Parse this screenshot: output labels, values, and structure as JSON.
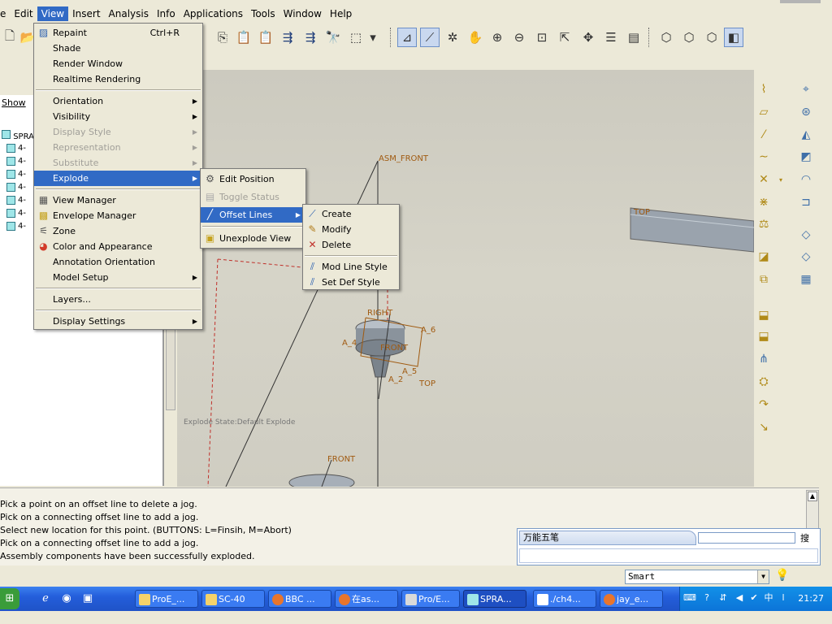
{
  "menubar": {
    "items": [
      "e",
      "Edit",
      "View",
      "Insert",
      "Analysis",
      "Info",
      "Applications",
      "Tools",
      "Window",
      "Help"
    ]
  },
  "view_menu": {
    "items": [
      {
        "label": "Repaint",
        "shortcut": "Ctrl+R"
      },
      {
        "label": "Shade"
      },
      {
        "label": "Render Window"
      },
      {
        "label": "Realtime Rendering"
      },
      {
        "label": "Orientation"
      },
      {
        "label": "Visibility"
      },
      {
        "label": "Display Style"
      },
      {
        "label": "Representation"
      },
      {
        "label": "Substitute"
      },
      {
        "label": "Explode"
      },
      {
        "label": "View Manager"
      },
      {
        "label": "Envelope Manager"
      },
      {
        "label": "Zone"
      },
      {
        "label": "Color and Appearance"
      },
      {
        "label": "Annotation Orientation"
      },
      {
        "label": "Model Setup"
      },
      {
        "label": "Layers..."
      },
      {
        "label": "Display Settings"
      }
    ]
  },
  "explode_menu": {
    "items": [
      "Edit Position",
      "Toggle Status",
      "Offset Lines",
      "Unexplode View"
    ]
  },
  "offset_menu": {
    "items": [
      "Create",
      "Modify",
      "Delete",
      "Mod Line Style",
      "Set Def Style"
    ]
  },
  "tree": {
    "show_label": "Show",
    "root": "SPRAY-",
    "items": [
      "4-",
      "4-",
      "4-",
      "4-",
      "4-",
      "4-",
      "4-"
    ]
  },
  "viewport": {
    "labels": {
      "asm_front": "ASM_FRONT",
      "top_right": "TOP",
      "right": "RIGHT",
      "a6": "A_6",
      "a4": "A_4",
      "front_mid": "FRONT",
      "a5": "A_5",
      "a2": "A_2",
      "top_mid": "TOP",
      "front_low": "FRONT"
    },
    "explode_state": "Explode State:Default Explode"
  },
  "messages": [
    "Pick a point on an offset line to delete a jog.",
    "Pick on a connecting offset line to add a jog.",
    "Select new location for this point. (BUTTONS: L=Finsih, M=Abort)",
    "Pick on a connecting offset line to add a jog.",
    "Assembly components have been successfully exploded."
  ],
  "ime": {
    "title": "万能五笔",
    "search": "搜"
  },
  "status": {
    "filter": "Smart"
  },
  "taskbar": {
    "tasks": [
      "ProE_...",
      "SC-40",
      "BBC ...",
      "在as...",
      "Pro/E...",
      "SPRA...",
      "./ch4...",
      "jay_e..."
    ],
    "clock": "21:27"
  }
}
